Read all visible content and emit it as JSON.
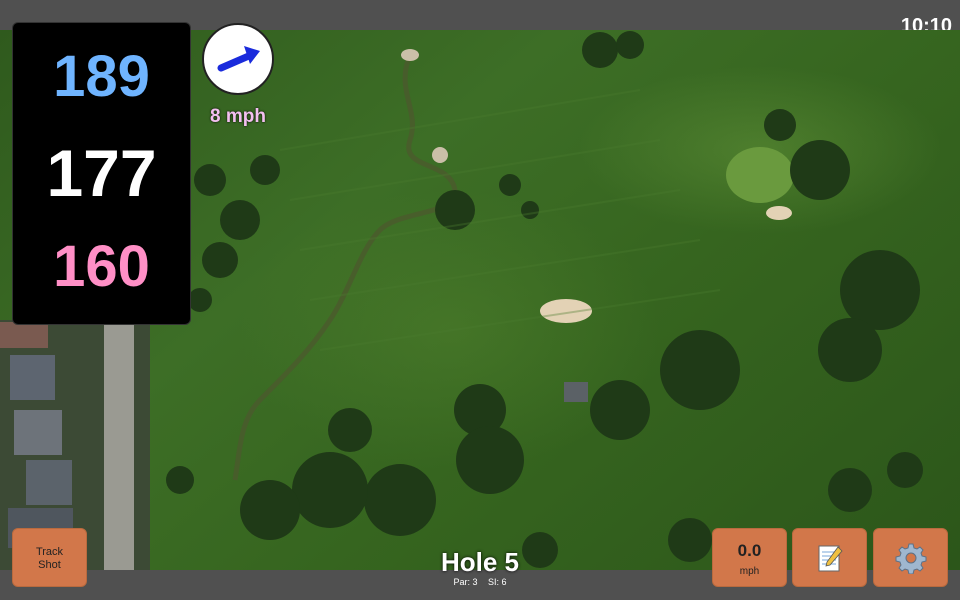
{
  "status": {
    "time": "10:10"
  },
  "yardages": {
    "back": "189",
    "middle": "177",
    "front": "160"
  },
  "wind": {
    "speed": "8 mph",
    "icon": "wind-arrow-icon"
  },
  "hole": {
    "title": "Hole 5",
    "par": "Par: 3",
    "si": "SI: 6"
  },
  "buttons": {
    "track_line1": "Track",
    "track_line2": "Shot",
    "speed_value": "0.0",
    "speed_unit": "mph",
    "notes_icon": "notepad-icon",
    "settings_icon": "gear-icon"
  },
  "colors": {
    "back": "#6fb4ff",
    "middle": "#ffffff",
    "front": "#ff8fc6",
    "button": "#d2774a",
    "wind_text": "#f3c0f0"
  }
}
